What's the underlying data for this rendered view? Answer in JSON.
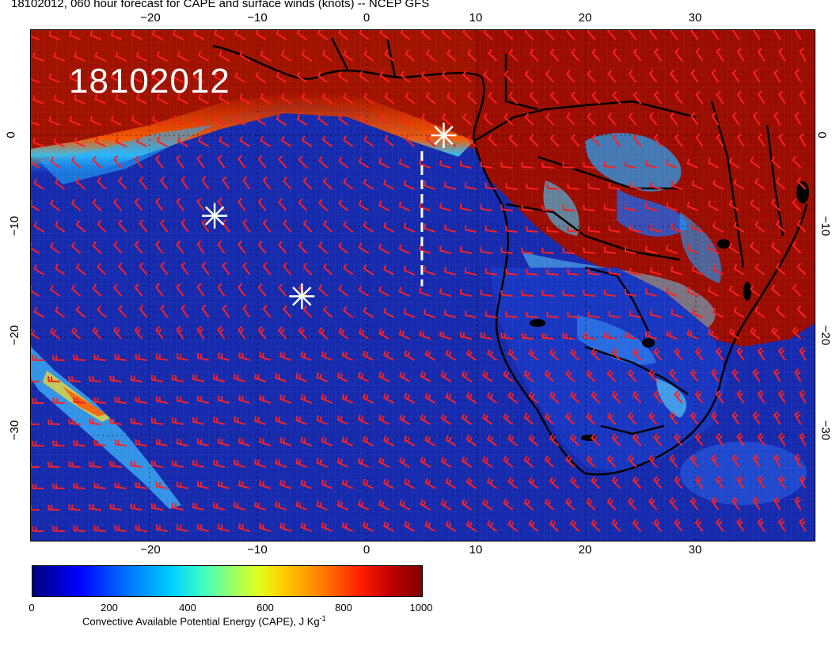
{
  "header": {
    "title": "18102012, 060 hour forecast for CAPE and surface winds (knots) -- NCEP GFS"
  },
  "map": {
    "date_stamp": "18102012",
    "lon_ticks": [
      "−20",
      "−10",
      "0",
      "10",
      "20",
      "30"
    ],
    "lat_ticks": [
      "0",
      "−10",
      "−20",
      "−30"
    ],
    "colors": {
      "ocean_low": "#0a1a9a",
      "high_cape": "#9a0a00",
      "wind_barb": "#ff2020",
      "coastline": "#000000",
      "markers": "#ffffff"
    },
    "markers": [
      {
        "name": "star-marker",
        "lon": 7,
        "lat": 0
      },
      {
        "name": "star-marker",
        "lon": -14,
        "lat": -8
      },
      {
        "name": "star-marker",
        "lon": -6,
        "lat": -16
      }
    ],
    "dashed_line": {
      "lon": 5,
      "lat_start": 0,
      "lat_end": -15
    }
  },
  "colorbar": {
    "tick_labels": [
      "0",
      "200",
      "400",
      "600",
      "800",
      "1000"
    ],
    "label_main": "Convective Available Potential Energy (CAPE), J Kg",
    "label_sup": "-1"
  }
}
